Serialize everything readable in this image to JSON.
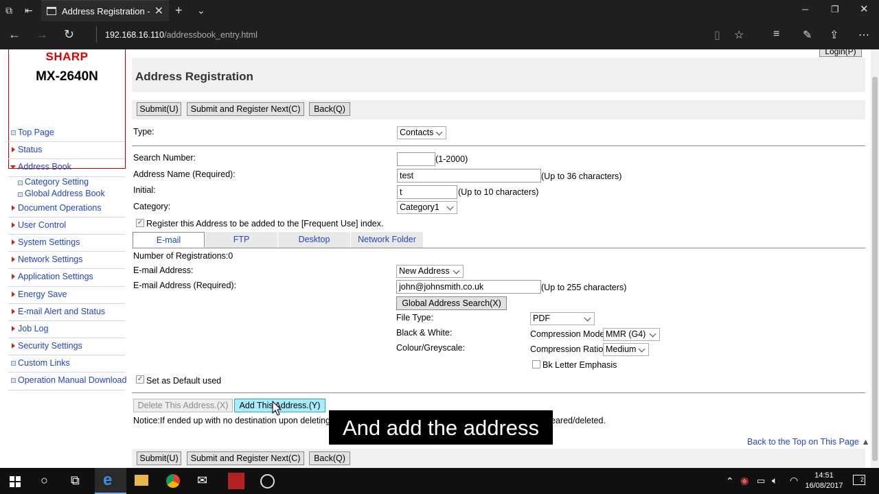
{
  "browser": {
    "tab_title": "Address Registration - M",
    "url_host": "192.168.16.110",
    "url_path": "/addressbook_entry.html"
  },
  "device": {
    "brand": "SHARP",
    "model": "MX-2640N"
  },
  "login_label": "Login(P)",
  "menu": [
    {
      "label": "Top Page",
      "type": "square"
    },
    {
      "label": "Status",
      "type": "arrow"
    },
    {
      "label": "Address Book",
      "type": "open"
    },
    {
      "label": "Category Setting",
      "type": "sub"
    },
    {
      "label": "Global Address Book",
      "type": "sub"
    },
    {
      "label": "Document Operations",
      "type": "arrow"
    },
    {
      "label": "User Control",
      "type": "arrow"
    },
    {
      "label": "System Settings",
      "type": "arrow"
    },
    {
      "label": "Network Settings",
      "type": "arrow"
    },
    {
      "label": "Application Settings",
      "type": "arrow"
    },
    {
      "label": "Energy Save",
      "type": "arrow"
    },
    {
      "label": "E-mail Alert and Status",
      "type": "arrow"
    },
    {
      "label": "Job Log",
      "type": "arrow"
    },
    {
      "label": "Security Settings",
      "type": "arrow"
    },
    {
      "label": "Custom Links",
      "type": "square"
    },
    {
      "label": "Operation Manual Download",
      "type": "square"
    }
  ],
  "page_title": "Address Registration",
  "buttons": {
    "submit": "Submit(U)",
    "submit_next": "Submit and Register Next(C)",
    "back": "Back(Q)"
  },
  "form": {
    "type_label": "Type:",
    "type_value": "Contacts",
    "search_number_label": "Search Number:",
    "search_number_value": "",
    "search_number_hint": "(1-2000)",
    "address_name_label": "Address Name (Required):",
    "address_name_value": "test",
    "address_name_hint": "(Up to 36 characters)",
    "initial_label": "Initial:",
    "initial_value": "t",
    "initial_hint": "(Up to 10 characters)",
    "category_label": "Category:",
    "category_value": "Category1",
    "frequent_use_label": "Register this Address to be added to the [Frequent Use] index.",
    "frequent_use_checked": true
  },
  "tabs": [
    "E-mail",
    "FTP",
    "Desktop",
    "Network Folder"
  ],
  "email": {
    "registrations": "Number of Registrations:0",
    "address_label": "E-mail Address:",
    "address_select": "New Address",
    "required_label": "E-mail Address (Required):",
    "required_value": "john@johnsmith.co.uk",
    "required_hint": "(Up to 255 characters)",
    "global_search": "Global Address Search(X)",
    "file_type_label": "File Type:",
    "file_type_value": "PDF",
    "bw_label": "Black & White:",
    "compression_mode_label": "Compression Mode:",
    "compression_mode_value": "MMR (G4)",
    "colour_label": "Colour/Greyscale:",
    "compression_ratio_label": "Compression Ratio:",
    "compression_ratio_value": "Medium",
    "bk_letter_label": "Bk Letter Emphasis",
    "default_label": "Set as Default used",
    "delete_address": "Delete This Address.(X)",
    "add_address": "Add This Address.(Y)",
    "notice_left": "Notice:If ended up with no destination upon deleting a",
    "notice_right": "eared/deleted."
  },
  "back_to_top": "Back to the Top on This Page",
  "caption": "And add the address",
  "taskbar": {
    "time": "14:51",
    "date": "16/08/2017",
    "notifications": "2"
  }
}
